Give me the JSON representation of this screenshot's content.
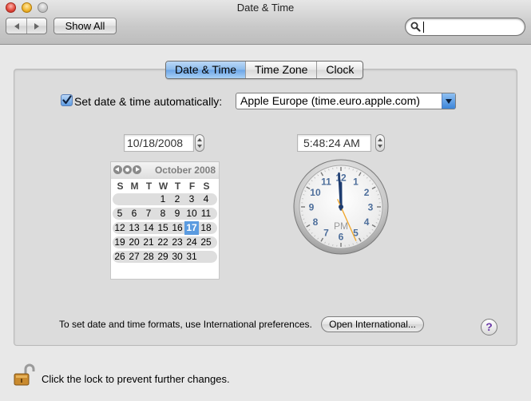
{
  "window": {
    "title": "Date & Time",
    "show_all_label": "Show All",
    "search": {
      "value": "",
      "placeholder": ""
    }
  },
  "tabs": [
    {
      "label": "Date & Time",
      "active": true
    },
    {
      "label": "Time Zone",
      "active": false
    },
    {
      "label": "Clock",
      "active": false
    }
  ],
  "auto": {
    "checked": true,
    "label": "Set date & time automatically:",
    "server": "Apple Europe (time.euro.apple.com)"
  },
  "date_field": "10/18/2008",
  "time_field": "5:48:24 AM",
  "calendar": {
    "month_title": "October 2008",
    "dow": [
      "S",
      "M",
      "T",
      "W",
      "T",
      "F",
      "S"
    ],
    "weeks": [
      [
        "",
        "",
        "",
        "1",
        "2",
        "3",
        "4"
      ],
      [
        "5",
        "6",
        "7",
        "8",
        "9",
        "10",
        "11"
      ],
      [
        "12",
        "13",
        "14",
        "15",
        "16",
        "17",
        "18"
      ],
      [
        "19",
        "20",
        "21",
        "22",
        "23",
        "24",
        "25"
      ],
      [
        "26",
        "27",
        "28",
        "29",
        "30",
        "31",
        ""
      ]
    ],
    "selected_day": "17"
  },
  "clock": {
    "numbers": [
      "12",
      "1",
      "2",
      "3",
      "4",
      "5",
      "6",
      "7",
      "8",
      "9",
      "10",
      "11"
    ],
    "period": "PM",
    "hour": 11,
    "minute": 59,
    "second": 26,
    "accent_color": "#f0a830"
  },
  "footer": {
    "formats_text": "To set date and time formats, use International preferences.",
    "open_international_label": "Open International...",
    "help_label": "?",
    "lock_text": "Click the lock to prevent further changes."
  }
}
